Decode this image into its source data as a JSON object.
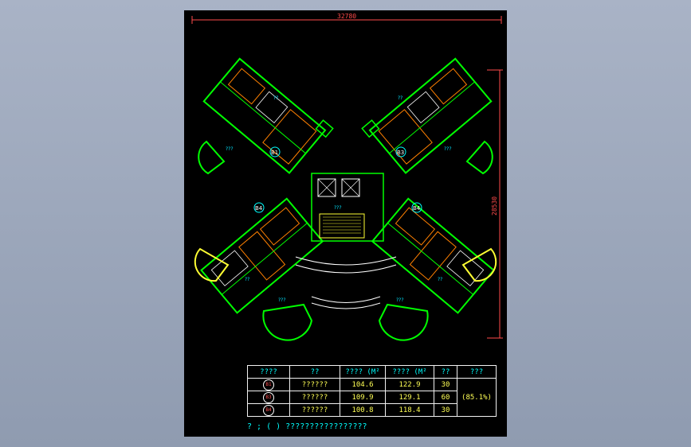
{
  "dimensions": {
    "width": "32780",
    "height": "28530"
  },
  "room_labels": {
    "room_a": "??",
    "room_b": "???",
    "room_c": "???",
    "corridor": "???",
    "unit_1": "B1",
    "unit_2": "B3",
    "unit_3": "B4",
    "unit_4": "B4"
  },
  "table": {
    "headers": [
      "????",
      "??",
      "???? (M²",
      "???? (M²",
      "??",
      "???"
    ],
    "rows": [
      {
        "mark": "B1",
        "type": "??????",
        "area1": "104.6",
        "area2": "122.9",
        "count": "30",
        "ratio": "(85.1%)"
      },
      {
        "mark": "B3",
        "type": "??????",
        "area1": "109.9",
        "area2": "129.1",
        "count": "60",
        "ratio": ""
      },
      {
        "mark": "B4",
        "type": "??????",
        "area1": "100.8",
        "area2": "118.4",
        "count": "30",
        "ratio": ""
      }
    ]
  },
  "note": "? ; (    ) ?????????????????",
  "colors": {
    "background": "#000000",
    "wall": "#00ff00",
    "detail": "#ff8000",
    "text": "#ffff55",
    "dimension": "#ff4b4b"
  }
}
